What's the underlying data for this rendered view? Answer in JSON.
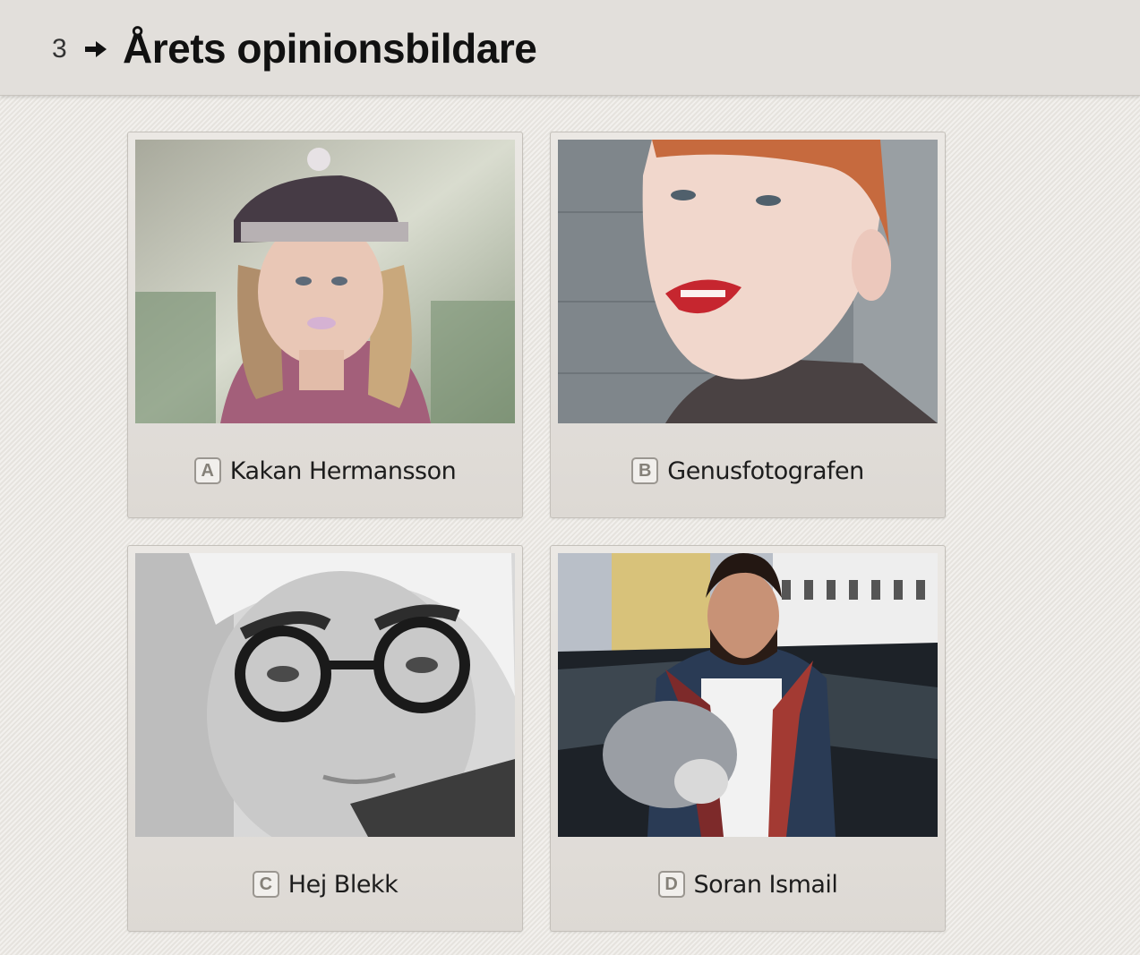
{
  "question": {
    "number": "3",
    "arrow_icon": "arrow-right-icon",
    "title": "Årets opinionsbildare"
  },
  "options": [
    {
      "key": "A",
      "name": "Kakan Hermansson"
    },
    {
      "key": "B",
      "name": "Genusfotografen"
    },
    {
      "key": "C",
      "name": "Hej Blekk"
    },
    {
      "key": "D",
      "name": "Soran Ismail"
    }
  ]
}
